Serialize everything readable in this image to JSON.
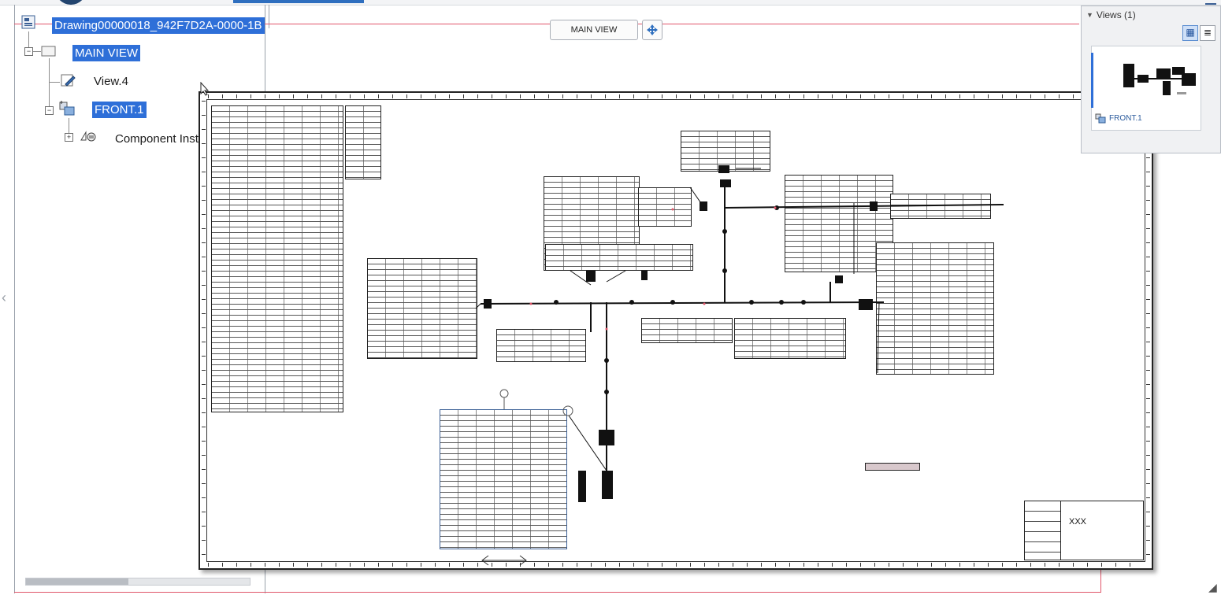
{
  "tree": {
    "root_label": "Drawing00000018_942F7D2A-0000-1B",
    "main_view_label": "MAIN VIEW",
    "view4_label": "View.4",
    "front1_label": "FRONT.1",
    "component_instances_label": "Component Instances",
    "expand_symbol": "+",
    "collapse_symbol": "−"
  },
  "view_selector": {
    "label": "MAIN VIEW"
  },
  "views_panel": {
    "title": "Views (1)",
    "thumbnail_label": "FRONT.1",
    "collapse_icon": "triangle-down-icon",
    "grid_view_icon": "grid-icon",
    "list_view_icon": "list-icon"
  },
  "sheet": {
    "title_block_text": "XXX"
  },
  "colors": {
    "selection": "#2e6fd8",
    "sheet_border": "#222222",
    "wire_red": "#e0566a",
    "panel_bg": "#f0f1f3"
  }
}
